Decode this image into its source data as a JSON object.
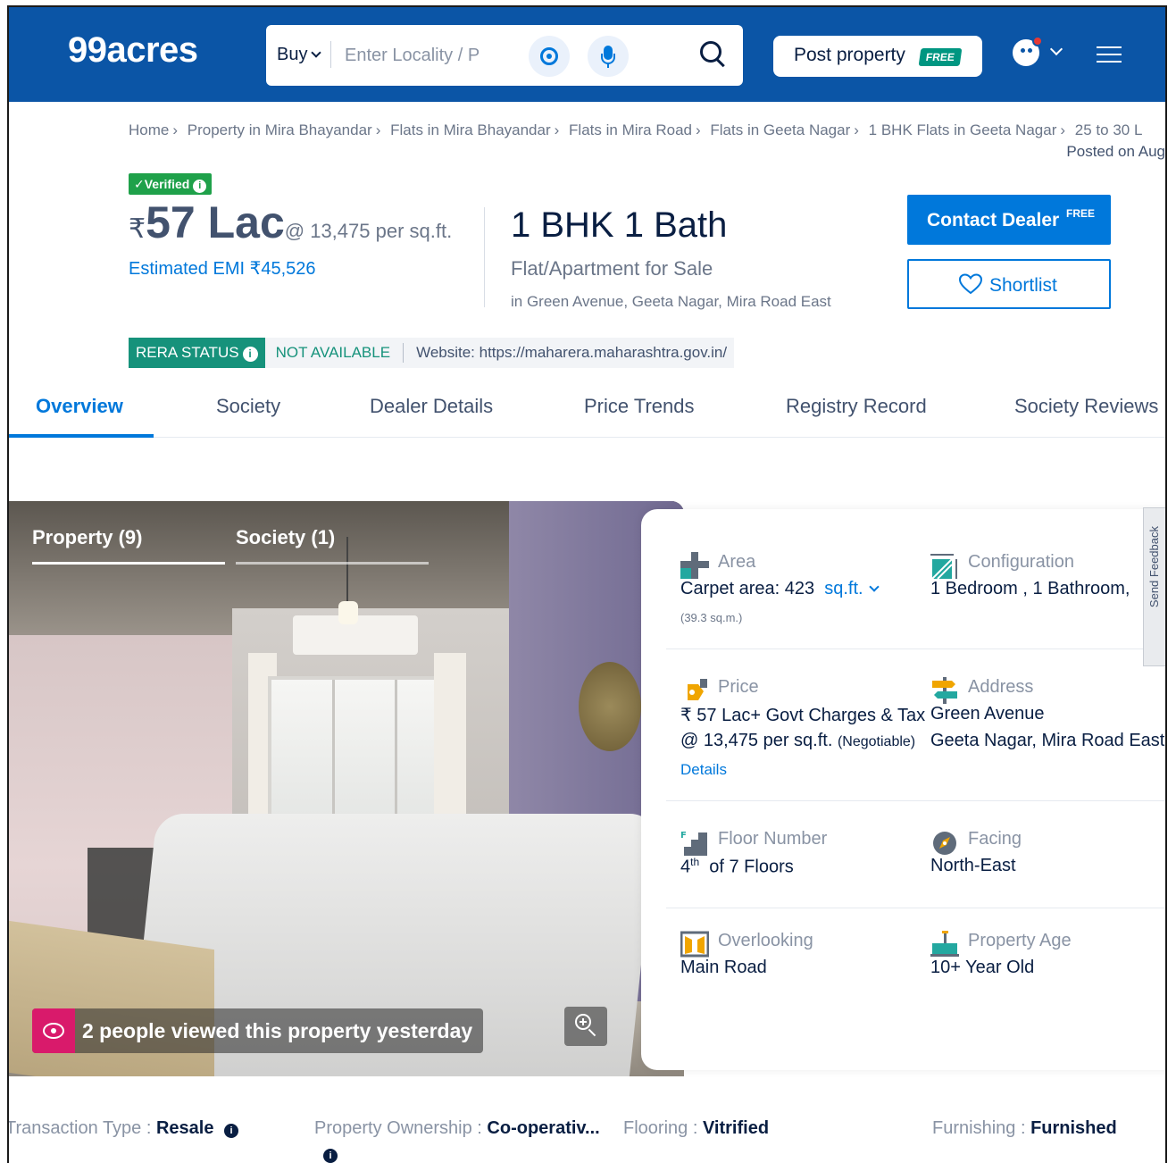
{
  "header": {
    "logo": "99acres",
    "search": {
      "mode": "Buy",
      "placeholder": "Enter Locality / P"
    },
    "post_property": {
      "label": "Post property",
      "badge": "FREE"
    }
  },
  "breadcrumb": {
    "items": [
      "Home",
      "Property in Mira Bhayandar",
      "Flats in Mira Bhayandar",
      "Flats in Mira Road",
      "Flats in Geeta Nagar",
      "1 BHK Flats in Geeta Nagar",
      "25 to 30 L"
    ],
    "separator": "›",
    "posted": "Posted on Aug"
  },
  "listing": {
    "verified": "Verified",
    "currency": "₹",
    "price": "57 Lac",
    "price_per_sqft": "@ 13,475 per sq.ft.",
    "emi": "Estimated EMI ₹45,526",
    "bhk_bath": "1 BHK 1 Bath",
    "property_type": "Flat/Apartment for Sale",
    "location": "in Green Avenue, Geeta Nagar, Mira Road East",
    "contact": {
      "label": "Contact Dealer",
      "badge": "FREE"
    },
    "shortlist": "Shortlist"
  },
  "rera": {
    "status_label": "RERA STATUS",
    "status_value": "NOT AVAILABLE",
    "website": "Website: https://maharera.maharashtra.gov.in/"
  },
  "tabs": [
    "Overview",
    "Society",
    "Dealer Details",
    "Price Trends",
    "Registry Record",
    "Society Reviews"
  ],
  "gallery": {
    "tab_property": "Property (9)",
    "tab_society": "Society (1)",
    "viewed": "2 people viewed this property yesterday"
  },
  "details": {
    "area": {
      "label": "Area",
      "value": "Carpet area: 423",
      "unit": "sq.ft.",
      "sub": "(39.3 sq.m.)"
    },
    "configuration": {
      "label": "Configuration",
      "value": "1 Bedroom , 1 Bathroom,"
    },
    "price": {
      "label": "Price",
      "line1": "₹ 57 Lac+ Govt Charges & Tax",
      "line2": "@ 13,475 per sq.ft.",
      "negotiable": "(Negotiable)",
      "link": "Details"
    },
    "address": {
      "label": "Address",
      "line1": "Green Avenue",
      "line2": "Geeta Nagar, Mira Road East"
    },
    "floor": {
      "label": "Floor Number",
      "value": "4",
      "sup": "th",
      "rest": "of 7 Floors"
    },
    "facing": {
      "label": "Facing",
      "value": "North-East"
    },
    "overlooking": {
      "label": "Overlooking",
      "value": "Main Road"
    },
    "age": {
      "label": "Property Age",
      "value": "10+ Year Old"
    }
  },
  "feedback": "Send Feedback",
  "bottom": {
    "transaction": {
      "key": "Transaction Type",
      "value": "Resale"
    },
    "ownership": {
      "key": "Property Ownership",
      "value": "Co-operativ..."
    },
    "flooring": {
      "key": "Flooring",
      "value": "Vitrified"
    },
    "furnishing": {
      "key": "Furnishing",
      "value": "Furnished"
    }
  },
  "colors": {
    "brand": "#0b55a6",
    "accent": "#0078db",
    "rera": "#16927b",
    "verified": "#1fa14a",
    "viewed_badge": "#d91a6b"
  },
  "icons": [
    "location-target-icon",
    "mic-icon",
    "search-icon",
    "user-icon",
    "menu-icon",
    "heart-icon",
    "eye-icon",
    "zoom-icon",
    "info-icon"
  ]
}
